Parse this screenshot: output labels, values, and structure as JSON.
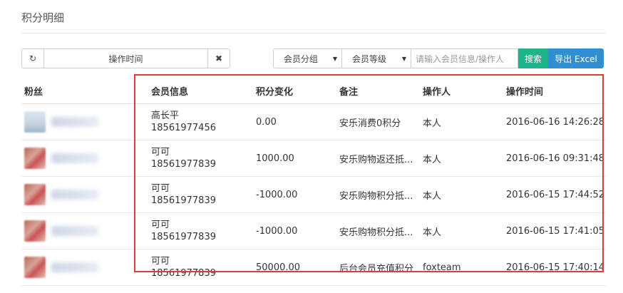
{
  "page": {
    "title": "积分明细"
  },
  "toolbar": {
    "refresh_icon": "refresh-icon",
    "date_label": "操作时间",
    "clear_icon": "close-icon",
    "group_select": "会员分组",
    "level_select": "会员等级",
    "search_placeholder": "请输入会员信息/操作人",
    "search_button": "搜索",
    "export_button": "导出 Excel",
    "colors": {
      "search_bg": "#1fb38a",
      "export_bg": "#2f8fd0",
      "highlight": "#e0393e"
    }
  },
  "table": {
    "headers": [
      "粉丝",
      "会员信息",
      "积分变化",
      "备注",
      "操作人",
      "操作时间"
    ],
    "rows": [
      {
        "name": "高长平",
        "phone": "18561977456",
        "change": "0.00",
        "note": "安乐消费0积分",
        "operator": "本人",
        "time": "2016-06-16 14:26:28"
      },
      {
        "name": "可可",
        "phone": "18561977839",
        "change": "1000.00",
        "note": "安乐购物返还抵...",
        "operator": "本人",
        "time": "2016-06-16 09:31:48"
      },
      {
        "name": "可可",
        "phone": "18561977839",
        "change": "-1000.00",
        "note": "安乐购物积分抵...",
        "operator": "本人",
        "time": "2016-06-15 17:44:52"
      },
      {
        "name": "可可",
        "phone": "18561977839",
        "change": "-1000.00",
        "note": "安乐购物积分抵...",
        "operator": "本人",
        "time": "2016-06-15 17:41:05"
      },
      {
        "name": "可可",
        "phone": "18561977839",
        "change": "50000.00",
        "note": "后台会员充值积分",
        "operator": "foxteam",
        "time": "2016-06-15 17:40:14"
      }
    ]
  }
}
